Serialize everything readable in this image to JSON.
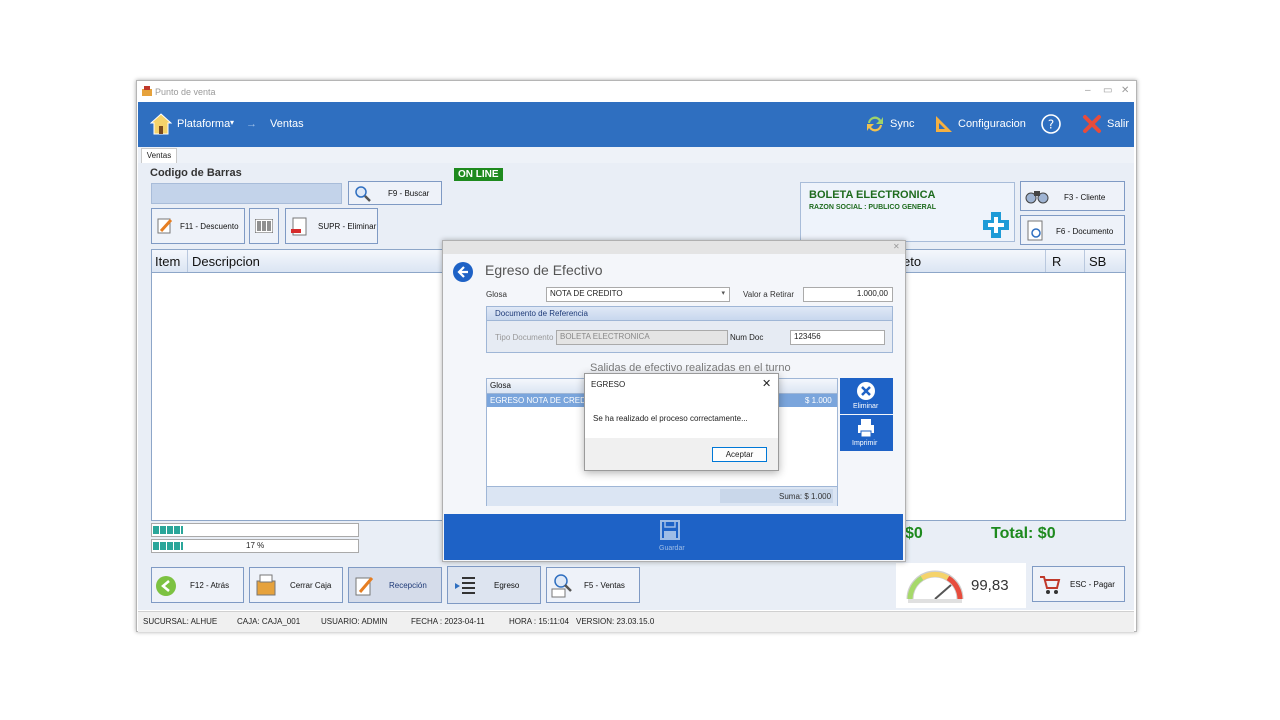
{
  "window": {
    "title": "Punto de venta",
    "controls": [
      "–",
      "▭",
      "✕"
    ]
  },
  "ribbon": {
    "plataforma": "Plataforma",
    "arrow": "→",
    "ventas": "Ventas",
    "sync": "Sync",
    "configuracion": "Configuracion",
    "salir": "Salir"
  },
  "tab": {
    "ventas": "Ventas"
  },
  "left": {
    "codigo_label": "Codigo de Barras",
    "buscar": "F9 - Buscar",
    "descuento": "F11 - Descuento",
    "eliminar": "SUPR - Eliminar",
    "online": "ON LINE",
    "grid_headers": {
      "item": "Item",
      "descripcion": "Descripcion",
      "neto": "eto",
      "r": "R",
      "sb": "SB"
    },
    "progress_percent": "17 %",
    "progress_value": 0.17
  },
  "boleta": {
    "title": "BOLETA ELECTRONICA",
    "razon": "RAZON SOCIAL   :  PUBLICO GENERAL"
  },
  "right_buttons": {
    "cliente": "F3 - Cliente",
    "documento": "F6 - Documento"
  },
  "totals": {
    "sub": "$0",
    "total": "Total: $0"
  },
  "gauge": {
    "value": "99,83"
  },
  "pagar": "ESC - Pagar",
  "bottom": {
    "atras": "F12 - Atrás",
    "cerrar": "Cerrar Caja",
    "recepcion": "Recepción",
    "egreso": "Egreso",
    "f5ventas": "F5 - Ventas"
  },
  "egreso_dialog": {
    "title": "Egreso de Efectivo",
    "glosa_label": "Glosa",
    "glosa_value": "NOTA DE CREDITO",
    "valor_label": "Valor a Retirar",
    "valor_value": "1.000,00",
    "ref_header": "Documento de Referencia",
    "tipo_doc_label": "Tipo Documento",
    "tipo_doc_value": "BOLETA ELECTRONICA",
    "num_doc_label": "Num Doc",
    "num_doc_value": "123456",
    "salidas_title": "Salidas de efectivo realizadas en el turno",
    "grid_header": "Glosa",
    "row_glosa": "EGRESO NOTA DE CREDITO",
    "row_amount": "$ 1.000",
    "suma": "Suma: $ 1.000",
    "eliminar": "Eliminar",
    "imprimir": "Imprimir",
    "guardar": "Guardar"
  },
  "msgbox": {
    "title": "EGRESO",
    "message": "Se ha realizado el proceso correctamente...",
    "ok": "Aceptar"
  },
  "status": {
    "sucursal": "SUCURSAL: ALHUE",
    "caja": "CAJA: CAJA_001",
    "usuario": "USUARIO: ADMIN",
    "fecha": "FECHA : 2023-04-11",
    "hora": "HORA : 15:11:04",
    "version": "VERSION: 23.03.15.0"
  },
  "colors": {
    "ribbon": "#2f6fc0",
    "online": "#1e8a1e",
    "total": "#1e8a1e",
    "dialog_footer": "#1e62c6"
  }
}
